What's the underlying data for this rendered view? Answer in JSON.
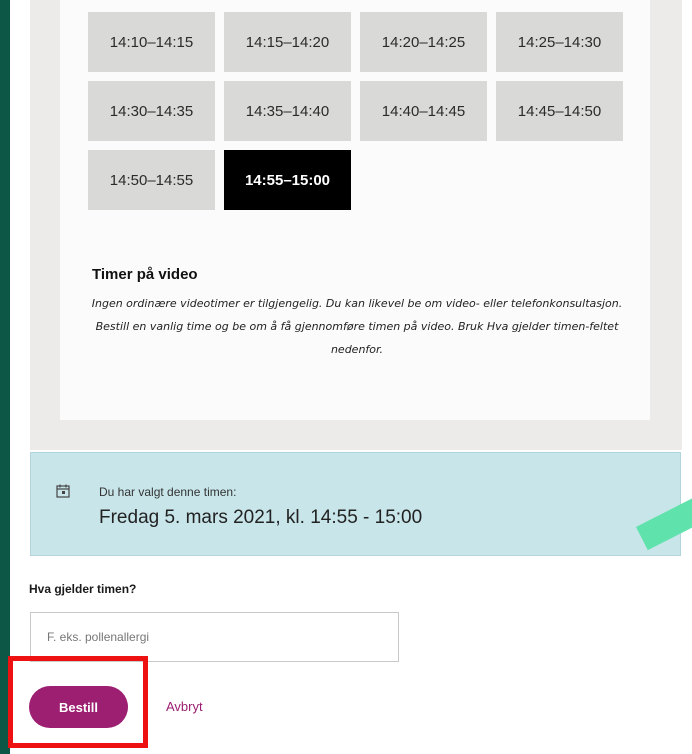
{
  "time_slots": [
    {
      "label": "14:10–14:15",
      "selected": false
    },
    {
      "label": "14:15–14:20",
      "selected": false
    },
    {
      "label": "14:20–14:25",
      "selected": false
    },
    {
      "label": "14:25–14:30",
      "selected": false
    },
    {
      "label": "14:30–14:35",
      "selected": false
    },
    {
      "label": "14:35–14:40",
      "selected": false
    },
    {
      "label": "14:40–14:45",
      "selected": false
    },
    {
      "label": "14:45–14:50",
      "selected": false
    },
    {
      "label": "14:50–14:55",
      "selected": false
    },
    {
      "label": "14:55–15:00",
      "selected": true
    }
  ],
  "video": {
    "title": "Timer på video",
    "text": "Ingen ordinære videotimer er tilgjengelig. Du kan likevel be om video- eller telefonkonsultasjon. Bestill en vanlig time og be om å få gjennomføre timen på video. Bruk Hva gjelder timen-feltet nedenfor."
  },
  "selection": {
    "label": "Du har valgt denne timen:",
    "value": "Fredag 5. mars 2021, kl. 14:55 - 15:00",
    "icon": "calendar-icon"
  },
  "reason": {
    "label": "Hva gjelder timen?",
    "placeholder": "F. eks. pollenallergi",
    "value": ""
  },
  "actions": {
    "submit_label": "Bestill",
    "cancel_label": "Avbryt"
  },
  "colors": {
    "page_background": "#0d5747",
    "selected_slot": "#000000",
    "slot": "#d9d9d7",
    "selection_box": "#c8e5ea",
    "primary_button": "#9c1f71",
    "highlight": "#ee1111",
    "decoration": "#5fe2ac"
  }
}
